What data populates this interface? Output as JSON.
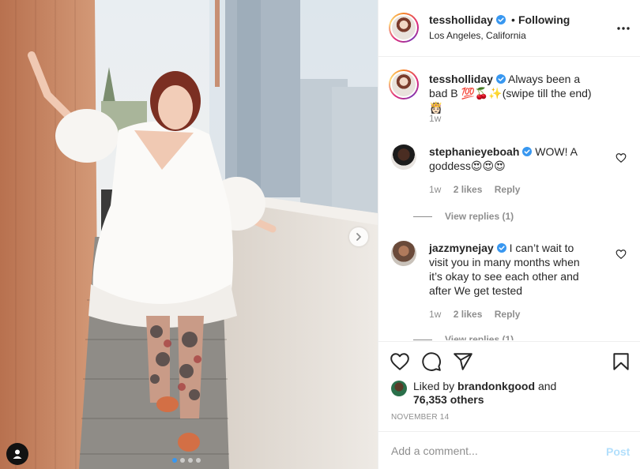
{
  "post": {
    "author": {
      "username": "tessholliday",
      "location": "Los Angeles, California",
      "follow_separator": "•",
      "follow_label": "Following"
    },
    "photo": {
      "slide_count": 4,
      "active_slide": 1
    },
    "caption": {
      "username": "tessholliday",
      "text": "Always been a bad B 💯🍒✨(swipe till the end) 👸🏻",
      "age": "1w"
    },
    "comments": [
      {
        "username": "stephanieyeboah",
        "text": "WOW! A goddess😍😍😍",
        "age": "1w",
        "likes": "2 likes",
        "reply_label": "Reply",
        "view_replies": "View replies (1)"
      },
      {
        "username": "jazzmynejay",
        "text": "I can’t wait to visit you in many months when it’s okay to see each other and after We get tested",
        "age": "1w",
        "likes": "2 likes",
        "reply_label": "Reply",
        "view_replies": "View replies (1)"
      }
    ],
    "liked_by": {
      "prefix": "Liked by",
      "user": "brandonkgood",
      "joiner": "and",
      "others": "76,353 others"
    },
    "date": "NOVEMBER 14",
    "comment_input": {
      "placeholder": "Add a comment...",
      "post_label": "Post"
    },
    "colors": {
      "accent_blue": "#3897f0",
      "post_disabled": "#b2dffc",
      "muted_text": "#8e8e8e",
      "border": "#efefef"
    },
    "icons": [
      "verified-badge-icon",
      "more-options-icon",
      "heart-icon",
      "comment-icon",
      "share-icon",
      "bookmark-icon",
      "chevron-right-icon",
      "user-tag-icon"
    ]
  }
}
